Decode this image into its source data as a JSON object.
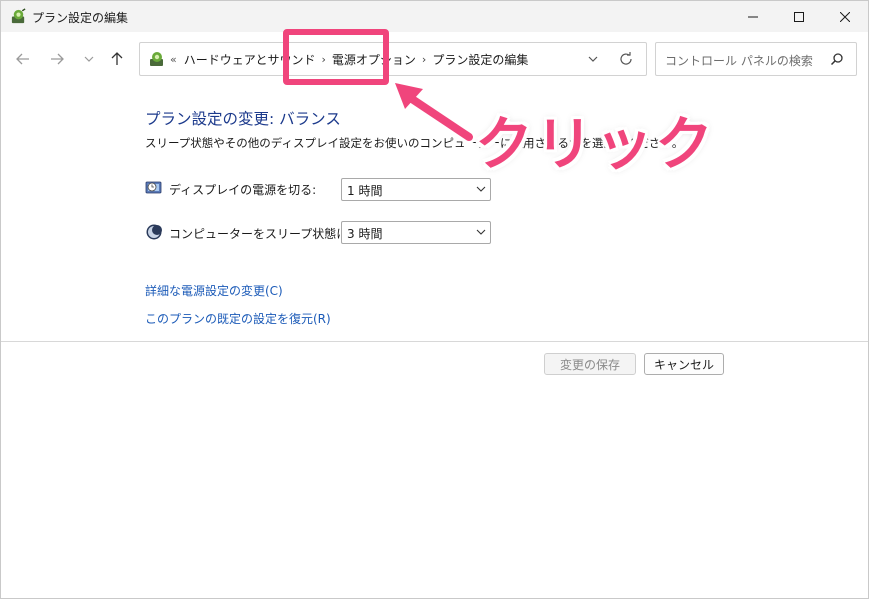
{
  "window": {
    "title": "プラン設定の編集",
    "icon": "power-options-icon"
  },
  "caption_buttons": [
    "minimize-icon",
    "maximize-icon",
    "close-icon"
  ],
  "navigation": {
    "back_icon": "arrow-left-icon",
    "forward_icon": "arrow-right-icon",
    "recent_icon": "chevron-down-icon",
    "up_icon": "arrow-up-icon"
  },
  "address": {
    "overflow": "«",
    "crumbs": [
      "ハードウェアとサウンド",
      "電源オプション",
      "プラン設定の編集"
    ],
    "separator": "›"
  },
  "search": {
    "placeholder": "コントロール パネルの検索"
  },
  "main": {
    "heading": "プラン設定の変更: バランス",
    "description": "スリープ状態やその他のディスプレイ設定をお使いのコンピューターに適用させるかを選んでください。",
    "settings": [
      {
        "label": "ディスプレイの電源を切る:",
        "value": "1 時間",
        "icon": "monitor-clock-icon"
      },
      {
        "label": "コンピューターをスリープ状態にする:",
        "value": "3 時間",
        "icon": "moon-icon"
      }
    ],
    "links": [
      "詳細な電源設定の変更(C)",
      "このプランの既定の設定を復元(R)"
    ]
  },
  "buttons": {
    "save": "変更の保存",
    "cancel": "キャンセル"
  },
  "annotation": {
    "text": "クリック",
    "color": "#f0457c"
  }
}
